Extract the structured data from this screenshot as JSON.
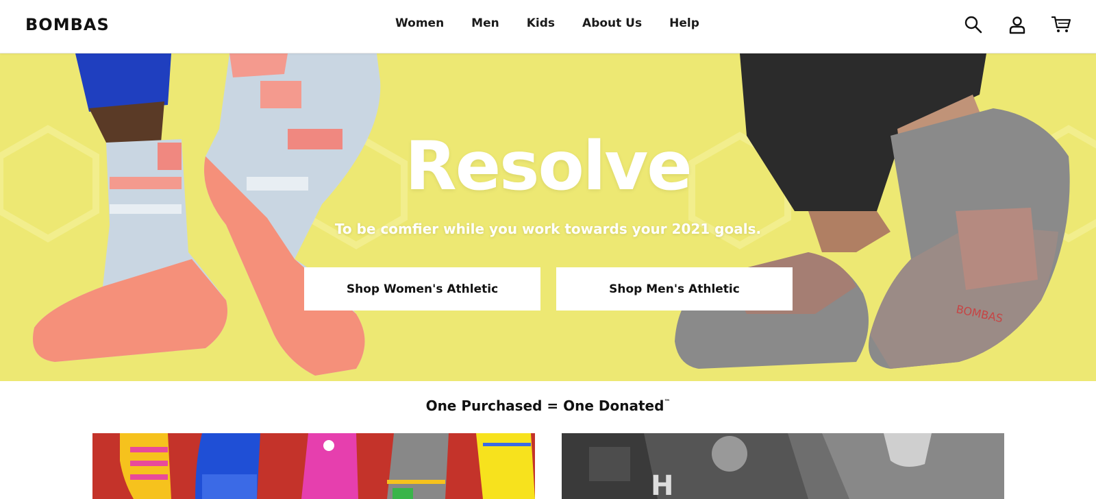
{
  "header": {
    "logo": "BOMBAS",
    "nav": [
      "Women",
      "Men",
      "Kids",
      "About Us",
      "Help"
    ],
    "icons": [
      "search-icon",
      "account-icon",
      "cart-icon"
    ]
  },
  "hero": {
    "title": "Resolve",
    "subtitle": "To be comfier while you work towards your 2021 goals.",
    "buttons": {
      "women": "Shop Women's Athletic",
      "men": "Shop Men's Athletic"
    },
    "background_color": "#ede873"
  },
  "section": {
    "heading": "One Purchased = One Donated",
    "trademark": "™"
  },
  "colors": {
    "brand_text": "#111111",
    "hero_yellow": "#ede873",
    "sock_coral": "#f5907a",
    "sock_grey": "#8a8a8a",
    "card_red": "#c4332a"
  }
}
